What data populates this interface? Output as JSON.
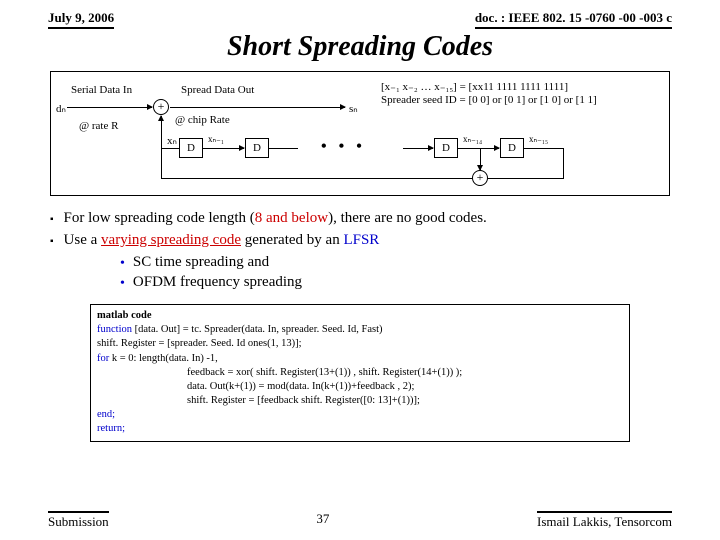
{
  "header": {
    "date": "July 9, 2006",
    "docref": "doc. : IEEE 802. 15 -0760 -00 -003 c"
  },
  "title": "Short Spreading Codes",
  "diagram": {
    "serial_in": "Serial Data In",
    "dn": "dₙ",
    "rate": "@ rate R",
    "adder1": "+",
    "spread_out": "Spread Data Out",
    "chip_rate": "@ chip Rate",
    "sn": "sₙ",
    "seed1": "[x₋₁ x₋₂ … x₋₁₅]     = [xx11 1111 1111 1111]",
    "seed2": "Spreader seed ID = [0 0] or [0 1] or [1 0] or [1 1]",
    "xn": "xₙ",
    "xn1": "xₙ₋₁",
    "xn14": "xₙ₋₁₄",
    "xn15": "xₙ₋₁₅",
    "D": "D",
    "adder2": "+"
  },
  "bullets": {
    "b1a": "For low spreading code length (",
    "b1b": "8 and below",
    "b1c": "), there are no good codes.",
    "b2a": "Use a ",
    "b2b": "varying spreading code",
    "b2c": " generated by an ",
    "b2d": "LFSR",
    "s1": "SC time spreading and",
    "s2": "OFDM frequency spreading"
  },
  "code": {
    "l1": "matlab code",
    "l2a": "function",
    "l2b": " [data. Out] = tc. Spreader(data. In, spreader. Seed. Id, Fast)",
    "l3": "shift. Register  = [spreader. Seed. Id ones(1, 13)];",
    "l4a": "for",
    "l4b": " k = 0: length(data. In) -1,",
    "l5": "feedback       = xor( shift. Register(13+(1)) ,               shift. Register(14+(1)) );",
    "l6": "data. Out(k+(1)) = mod(data. In(k+(1))+feedback , 2);",
    "l7": "shift. Register  = [feedback shift. Register([0: 13]+(1))];",
    "l8": "end;",
    "l9": "return;"
  },
  "footer": {
    "left": "Submission",
    "page": "37",
    "right": "Ismail Lakkis, Tensorcom"
  }
}
